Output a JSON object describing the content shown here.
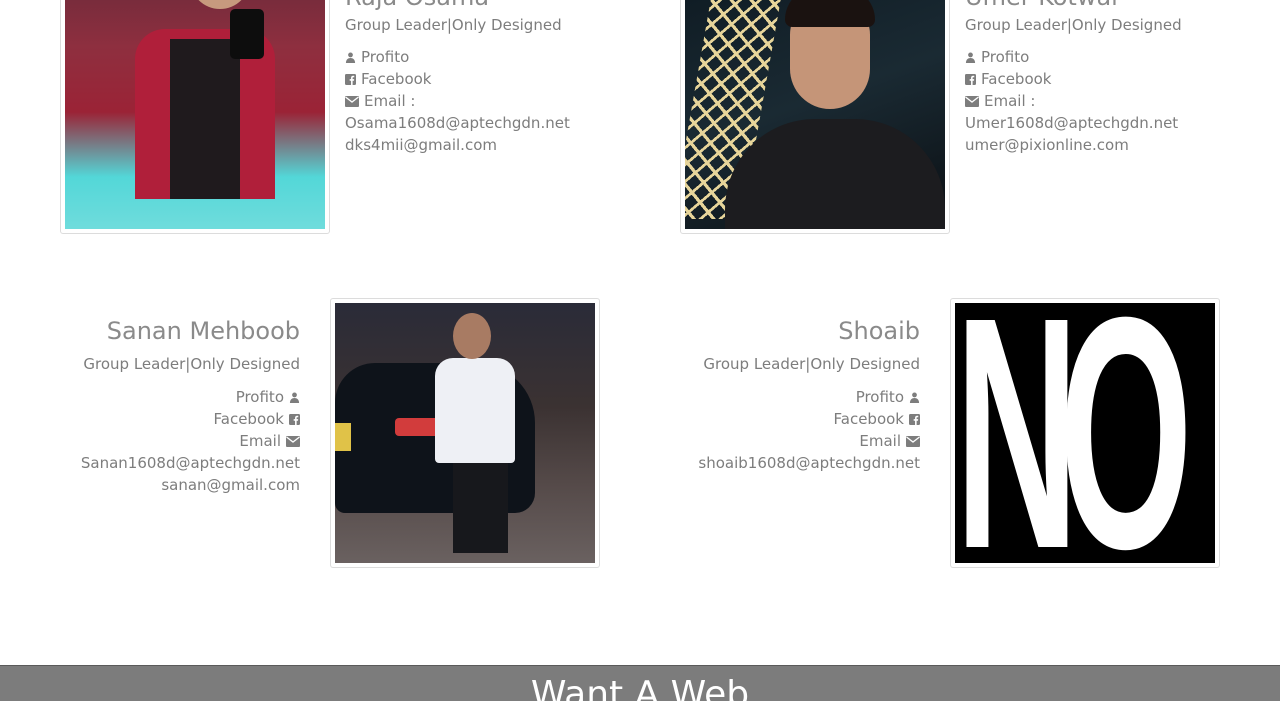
{
  "members": [
    {
      "name": "Raja Osama",
      "role": "Group Leader|Only Designed",
      "links": {
        "profile": "Profito",
        "facebook": "Facebook",
        "email": "Email :"
      },
      "emails": [
        "Osama1608d@aptechgdn.net",
        "dks4mii@gmail.com"
      ]
    },
    {
      "name": "Umer Kotwal",
      "role": "Group Leader|Only Designed",
      "links": {
        "profile": "Profito",
        "facebook": "Facebook",
        "email": "Email :"
      },
      "emails": [
        "Umer1608d@aptechgdn.net",
        "umer@pixionline.com"
      ]
    },
    {
      "name": "Sanan Mehboob",
      "role": "Group Leader|Only Designed",
      "links": {
        "profile": "Profito",
        "facebook": "Facebook",
        "email": "Email"
      },
      "emails": [
        "Sanan1608d@aptechgdn.net",
        "sanan@gmail.com"
      ]
    },
    {
      "name": "Shoaib",
      "role": "Group Leader|Only Designed",
      "links": {
        "profile": "Profito",
        "facebook": "Facebook",
        "email": "Email"
      },
      "emails": [
        "shoaib1608d@aptechgdn.net"
      ],
      "photo_text": "NO"
    }
  ],
  "footer": {
    "title": "Want A Web"
  },
  "icons": {
    "profile": "user-icon",
    "facebook": "facebook-icon",
    "email": "envelope-icon"
  }
}
